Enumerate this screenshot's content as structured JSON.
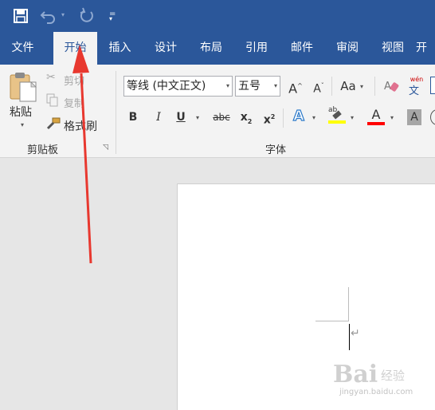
{
  "quick_access": {
    "save_icon": "save-icon",
    "undo_icon": "undo-icon",
    "redo_icon": "redo-icon",
    "customize_icon": "customize-qat-icon"
  },
  "tabs": [
    {
      "label": "文件"
    },
    {
      "label": "开始"
    },
    {
      "label": "插入"
    },
    {
      "label": "设计"
    },
    {
      "label": "布局"
    },
    {
      "label": "引用"
    },
    {
      "label": "邮件"
    },
    {
      "label": "审阅"
    },
    {
      "label": "视图"
    },
    {
      "label": "开"
    }
  ],
  "clipboard": {
    "paste_label": "粘贴",
    "cut_label": "剪切",
    "copy_label": "复制",
    "format_painter_label": "格式刷",
    "group_label": "剪贴板"
  },
  "font": {
    "font_name": "等线 (中文正文)",
    "font_size": "五号",
    "grow_label": "A",
    "shrink_label": "A",
    "case_label": "Aa",
    "pinyin_top": "wén",
    "pinyin_bottom": "文",
    "bold": "B",
    "italic": "I",
    "underline": "U",
    "strike": "abc",
    "subscript": "x",
    "subscript_mark": "2",
    "superscript": "x",
    "superscript_mark": "2",
    "effects": "A",
    "highlight": "ab",
    "font_color": "A",
    "shading": "A",
    "group_label": "字体"
  },
  "colors": {
    "brand": "#2b579a",
    "highlight": "#ffff00",
    "font_color": "#ff0000",
    "arrow": "#e8382f"
  },
  "document": {
    "paragraph_mark": "↵"
  },
  "watermark": {
    "text": "Bai",
    "site": "jingyan.baidu.com",
    "brand": "经验"
  }
}
